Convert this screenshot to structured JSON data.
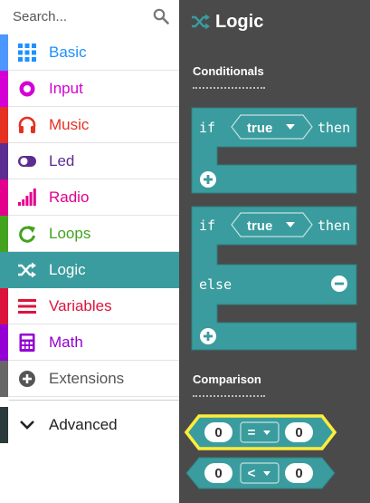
{
  "search": {
    "placeholder": "Search..."
  },
  "categories": [
    {
      "label": "Basic",
      "color": "#1e90ff",
      "icon": "grid-icon"
    },
    {
      "label": "Input",
      "color": "#d400d4",
      "icon": "target-icon"
    },
    {
      "label": "Music",
      "color": "#e63022",
      "icon": "headphones-icon"
    },
    {
      "label": "Led",
      "color": "#5c2d91",
      "icon": "toggle-icon"
    },
    {
      "label": "Radio",
      "color": "#e3008c",
      "icon": "signal-bars-icon"
    },
    {
      "label": "Loops",
      "color": "#00a4a6",
      "icon": "refresh-icon"
    },
    {
      "label": "Logic",
      "color": "#00a4a6",
      "icon": "shuffle-icon"
    },
    {
      "label": "Variables",
      "color": "#dc143c",
      "icon": "list-icon"
    },
    {
      "label": "Math",
      "color": "#9400d3",
      "icon": "calculator-icon"
    },
    {
      "label": "Extensions",
      "color": "#666666",
      "icon": "plus-circle-icon"
    }
  ],
  "advanced": {
    "label": "Advanced"
  },
  "flyout": {
    "title": "Logic",
    "sections": {
      "conditionals": "Conditionals",
      "comparison": "Comparison"
    },
    "blocks": {
      "if_keyword": "if",
      "then_keyword": "then",
      "else_keyword": "else",
      "true_value": "true",
      "eq_left": "0",
      "eq_op": "=",
      "eq_right": "0",
      "lt_left": "0",
      "lt_op": "<",
      "lt_right": "0"
    }
  },
  "colors": {
    "selected": "#3a9c9e",
    "block": "#3a9c9e",
    "block_dark": "#2f7f80",
    "flyout_bg": "#4a4a4a",
    "highlight": "#ffed3b"
  }
}
